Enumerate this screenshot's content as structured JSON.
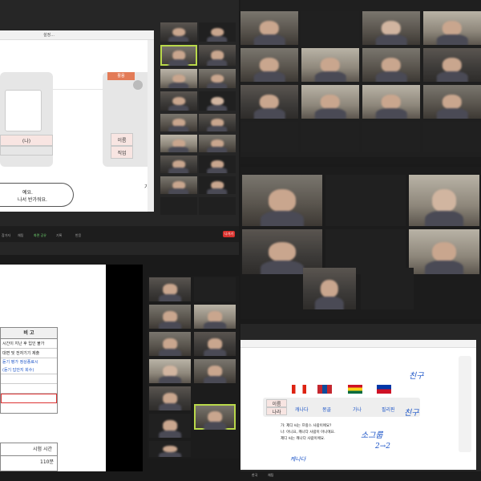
{
  "top_left_window": {
    "url_text": "설정...",
    "tab_label": "활용",
    "table_header": "(나)",
    "row1": "이름",
    "row2": "직업",
    "bubble_line1": "예요.",
    "bubble_line2": "나서 반가워요.",
    "side_text": "가",
    "toolbar_badge": "나가기",
    "toolbar_labels": [
      "참가자",
      "채팅",
      "화면 공유",
      "기록",
      "반응"
    ]
  },
  "bottom_left_doc": {
    "header": "비 고",
    "lines": [
      "시간이 지난 후 입인 불가",
      "대면 및 전자기기 제출",
      "듣기 평가 정상종료시",
      "(듣기 답안지 회수)"
    ],
    "exam_time_label": "시험 시간",
    "exam_time_value": "110분"
  },
  "bottom_right_lesson": {
    "flags": [
      "캐나다",
      "몽골",
      "가나",
      "필리핀"
    ],
    "row_label_1": "이름",
    "row_label_2": "나라",
    "dialog_lines": [
      "가: 제디 씨는 프랑스 사람이에요?",
      "나: 아니요, 캐나다 사람이 아니에요.",
      "제디 씨는 캐나다 사람이에요."
    ],
    "handwriting": [
      "친구",
      "친구",
      "소그룹",
      "2→2",
      "캐나다"
    ],
    "chips": [
      "한국",
      "채팅"
    ]
  },
  "colors": {
    "accent_green": "#b9d84a",
    "leave_red": "#d8322e",
    "zoom_dark": "#242424",
    "blue_ink": "#1e56c8"
  }
}
